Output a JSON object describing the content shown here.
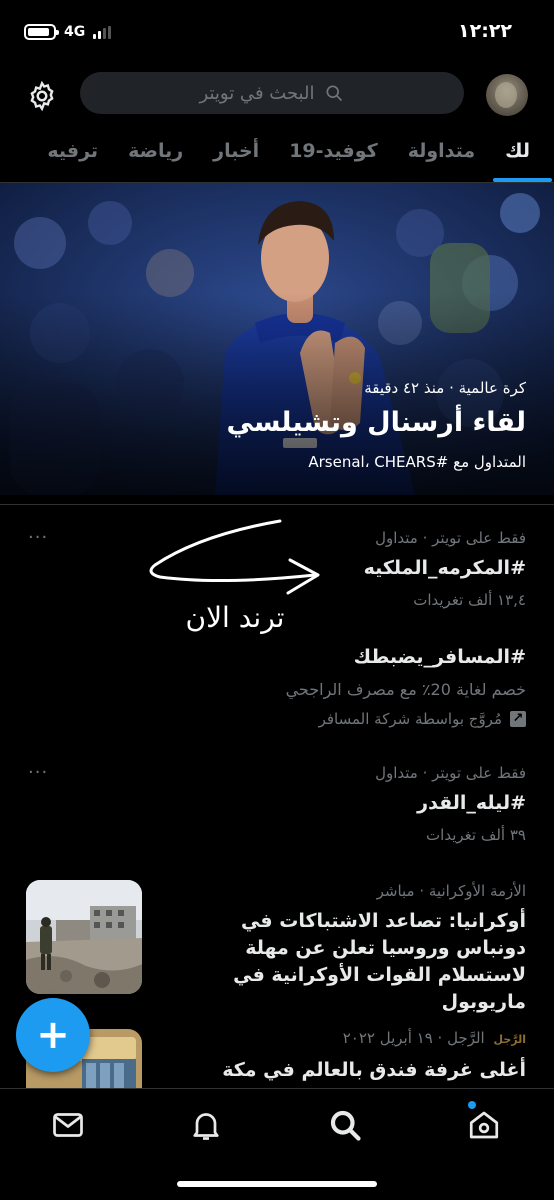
{
  "status_bar": {
    "time": "١٢:٢٢",
    "network": "4G"
  },
  "search": {
    "placeholder": "البحث في تويتر"
  },
  "tabs": [
    {
      "label": "لك",
      "active": true
    },
    {
      "label": "متداولة"
    },
    {
      "label": "كوفيد-19"
    },
    {
      "label": "أخبار"
    },
    {
      "label": "رياضة"
    },
    {
      "label": "ترفيه"
    }
  ],
  "hero": {
    "meta": "كرة عالمية · منذ ٤٢ دقيقة",
    "title": "لقاء أرسنال وتشيلسي",
    "trending": "المتداول مع #Arsenal، CHEARS"
  },
  "annotation": {
    "text": "ترند الان"
  },
  "trends": [
    {
      "meta": "فقط على تويتر · متداول",
      "title": "#المكرمه_الملكيه",
      "count": "١٣,٤ ألف تغريدات",
      "more": "···"
    },
    {
      "title": "#المسافر_يضبطك",
      "description": "خصم لغاية 20٪ مع مصرف الراجحي",
      "promoted": "مُروَّج بواسطة شركة المسافر"
    },
    {
      "meta": "فقط على تويتر · متداول",
      "title": "#ليله_القدر",
      "count": "٣٩ ألف تغريدات",
      "more": "···"
    }
  ],
  "news": [
    {
      "meta": "الأزمة الأوكرانية · مباشر",
      "title": "أوكرانيا: تصاعد الاشتباكات في دونباس وروسيا تعلن عن مهلة لاستسلام القوات الأوكرانية في ماريوبول"
    },
    {
      "publisher": "الرَّجل",
      "meta": "الرَّجل · ١٩ أبريل ٢٠٢٢",
      "title": "أغلى غرفة فندق بالعالم في مكة"
    }
  ],
  "fab": {
    "label": "+"
  },
  "colors": {
    "accent": "#1d9bf0",
    "background": "#000000",
    "text_primary": "#e7e9ea",
    "text_secondary": "#71767b"
  },
  "bottom_nav": [
    "mail-icon",
    "bell-icon",
    "search-icon",
    "home-icon"
  ]
}
